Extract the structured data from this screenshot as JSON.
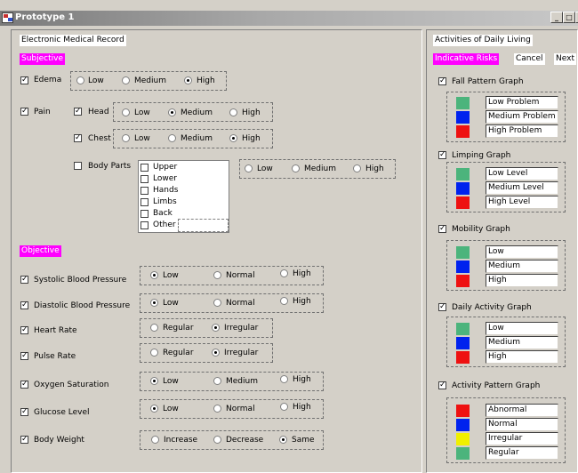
{
  "window": {
    "title": "Prototype 1",
    "min": "_",
    "max": "□",
    "close": "x"
  },
  "left": {
    "section_title": "Electronic Medical Record",
    "subjective": "Subjective",
    "objective": "Objective",
    "edema": {
      "label": "Edema",
      "options": [
        "Low",
        "Medium",
        "High"
      ]
    },
    "pain": {
      "label": "Pain",
      "head": {
        "label": "Head",
        "options": [
          "Low",
          "Medium",
          "High"
        ]
      },
      "chest": {
        "label": "Chest",
        "options": [
          "Low",
          "Medium",
          "High"
        ]
      },
      "body_parts": {
        "label": "Body Parts",
        "items": [
          "Upper",
          "Lower",
          "Hands",
          "Limbs",
          "Back",
          "Other"
        ],
        "options": [
          "Low",
          "Medium",
          "High"
        ]
      }
    },
    "vitals": [
      {
        "label": "Systolic Blood Pressure",
        "options": [
          "Low",
          "Normal",
          "High"
        ]
      },
      {
        "label": "Diastolic Blood Pressure",
        "options": [
          "Low",
          "Normal",
          "High"
        ]
      },
      {
        "label": "Heart Rate",
        "options": [
          "Regular",
          "Irregular"
        ]
      },
      {
        "label": "Pulse Rate",
        "options": [
          "Regular",
          "Irregular"
        ]
      },
      {
        "label": "Oxygen Saturation",
        "options": [
          "Low",
          "Medium",
          "High"
        ]
      },
      {
        "label": "Glucose Level",
        "options": [
          "Low",
          "Normal",
          "High"
        ]
      },
      {
        "label": "Body Weight",
        "options": [
          "Increase",
          "Decrease",
          "Same"
        ]
      }
    ]
  },
  "right": {
    "section_title": "Activities of Daily Living",
    "indicative": "Indicative Risks",
    "cancel": "Cancel",
    "next": "Next",
    "graphs": [
      {
        "label": "Fall Pattern Graph",
        "legend": [
          {
            "color": "#4cb47c",
            "text": "Low Problem"
          },
          {
            "color": "#0022ee",
            "text": "Medium Problem"
          },
          {
            "color": "#ee1111",
            "text": "High Problem"
          }
        ]
      },
      {
        "label": "Limping Graph",
        "legend": [
          {
            "color": "#4cb47c",
            "text": "Low Level"
          },
          {
            "color": "#0022ee",
            "text": "Medium Level"
          },
          {
            "color": "#ee1111",
            "text": "High Level"
          }
        ]
      },
      {
        "label": "Mobility Graph",
        "legend": [
          {
            "color": "#4cb47c",
            "text": "Low"
          },
          {
            "color": "#0022ee",
            "text": "Medium"
          },
          {
            "color": "#ee1111",
            "text": "High"
          }
        ]
      },
      {
        "label": "Daily Activity Graph",
        "legend": [
          {
            "color": "#4cb47c",
            "text": "Low"
          },
          {
            "color": "#0022ee",
            "text": "Medium"
          },
          {
            "color": "#ee1111",
            "text": "High"
          }
        ]
      },
      {
        "label": "Activity Pattern Graph",
        "legend": [
          {
            "color": "#ee1111",
            "text": "Abnormal"
          },
          {
            "color": "#0022ee",
            "text": "Normal"
          },
          {
            "color": "#f0f000",
            "text": "Irregular"
          },
          {
            "color": "#4cb47c",
            "text": "Regular"
          }
        ]
      }
    ]
  }
}
